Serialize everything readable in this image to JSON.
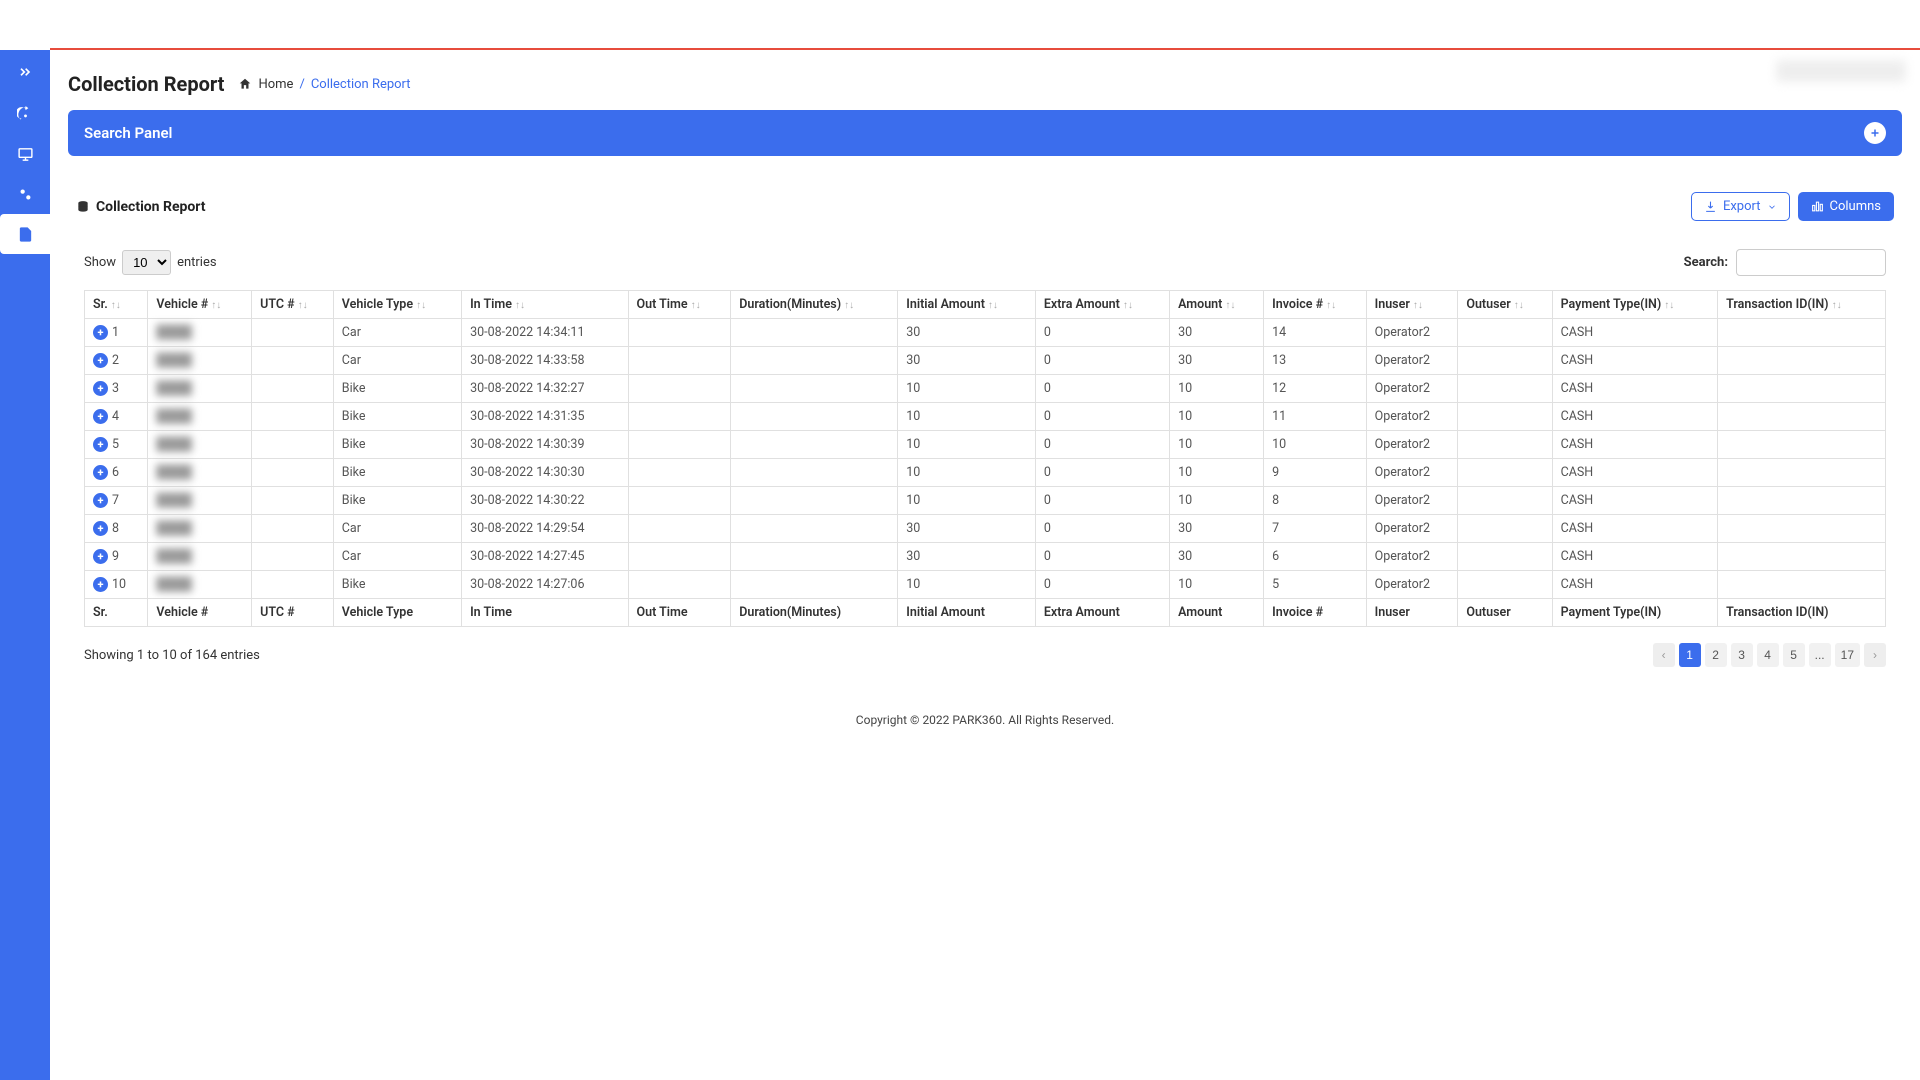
{
  "page": {
    "title": "Collection Report",
    "breadcrumb_home": "Home",
    "breadcrumb_current": "Collection Report",
    "breadcrumb_sep": "/"
  },
  "search_panel": {
    "title": "Search Panel"
  },
  "section": {
    "title": "Collection Report"
  },
  "buttons": {
    "export": "Export",
    "columns": "Columns"
  },
  "table_controls": {
    "show_label": "Show",
    "entries_label": "entries",
    "page_size": "10",
    "search_label": "Search:"
  },
  "columns": [
    "Sr.",
    "Vehicle #",
    "UTC #",
    "Vehicle Type",
    "In Time",
    "Out Time",
    "Duration(Minutes)",
    "Initial Amount",
    "Extra Amount",
    "Amount",
    "Invoice #",
    "Inuser",
    "Outuser",
    "Payment Type(IN)",
    "Transaction ID(IN)"
  ],
  "rows": [
    {
      "sr": "1",
      "vehicle": "",
      "utc": "",
      "type": "Car",
      "in": "30-08-2022 14:34:11",
      "out": "",
      "dur": "",
      "init": "30",
      "extra": "0",
      "amt": "30",
      "inv": "14",
      "inuser": "Operator2",
      "outuser": "",
      "pay": "CASH",
      "txn": ""
    },
    {
      "sr": "2",
      "vehicle": "",
      "utc": "",
      "type": "Car",
      "in": "30-08-2022 14:33:58",
      "out": "",
      "dur": "",
      "init": "30",
      "extra": "0",
      "amt": "30",
      "inv": "13",
      "inuser": "Operator2",
      "outuser": "",
      "pay": "CASH",
      "txn": ""
    },
    {
      "sr": "3",
      "vehicle": "",
      "utc": "",
      "type": "Bike",
      "in": "30-08-2022 14:32:27",
      "out": "",
      "dur": "",
      "init": "10",
      "extra": "0",
      "amt": "10",
      "inv": "12",
      "inuser": "Operator2",
      "outuser": "",
      "pay": "CASH",
      "txn": ""
    },
    {
      "sr": "4",
      "vehicle": "",
      "utc": "",
      "type": "Bike",
      "in": "30-08-2022 14:31:35",
      "out": "",
      "dur": "",
      "init": "10",
      "extra": "0",
      "amt": "10",
      "inv": "11",
      "inuser": "Operator2",
      "outuser": "",
      "pay": "CASH",
      "txn": ""
    },
    {
      "sr": "5",
      "vehicle": "",
      "utc": "",
      "type": "Bike",
      "in": "30-08-2022 14:30:39",
      "out": "",
      "dur": "",
      "init": "10",
      "extra": "0",
      "amt": "10",
      "inv": "10",
      "inuser": "Operator2",
      "outuser": "",
      "pay": "CASH",
      "txn": ""
    },
    {
      "sr": "6",
      "vehicle": "",
      "utc": "",
      "type": "Bike",
      "in": "30-08-2022 14:30:30",
      "out": "",
      "dur": "",
      "init": "10",
      "extra": "0",
      "amt": "10",
      "inv": "9",
      "inuser": "Operator2",
      "outuser": "",
      "pay": "CASH",
      "txn": ""
    },
    {
      "sr": "7",
      "vehicle": "",
      "utc": "",
      "type": "Bike",
      "in": "30-08-2022 14:30:22",
      "out": "",
      "dur": "",
      "init": "10",
      "extra": "0",
      "amt": "10",
      "inv": "8",
      "inuser": "Operator2",
      "outuser": "",
      "pay": "CASH",
      "txn": ""
    },
    {
      "sr": "8",
      "vehicle": "",
      "utc": "",
      "type": "Car",
      "in": "30-08-2022 14:29:54",
      "out": "",
      "dur": "",
      "init": "30",
      "extra": "0",
      "amt": "30",
      "inv": "7",
      "inuser": "Operator2",
      "outuser": "",
      "pay": "CASH",
      "txn": ""
    },
    {
      "sr": "9",
      "vehicle": "",
      "utc": "",
      "type": "Car",
      "in": "30-08-2022 14:27:45",
      "out": "",
      "dur": "",
      "init": "30",
      "extra": "0",
      "amt": "30",
      "inv": "6",
      "inuser": "Operator2",
      "outuser": "",
      "pay": "CASH",
      "txn": ""
    },
    {
      "sr": "10",
      "vehicle": "",
      "utc": "",
      "type": "Bike",
      "in": "30-08-2022 14:27:06",
      "out": "",
      "dur": "",
      "init": "10",
      "extra": "0",
      "amt": "10",
      "inv": "5",
      "inuser": "Operator2",
      "outuser": "",
      "pay": "CASH",
      "txn": ""
    }
  ],
  "footer_info": "Showing 1 to 10 of 164 entries",
  "pagination": {
    "pages": [
      "1",
      "2",
      "3",
      "4",
      "5",
      "...",
      "17"
    ],
    "active": "1"
  },
  "copyright": "Copyright © 2022 PARK360. All Rights Reserved."
}
